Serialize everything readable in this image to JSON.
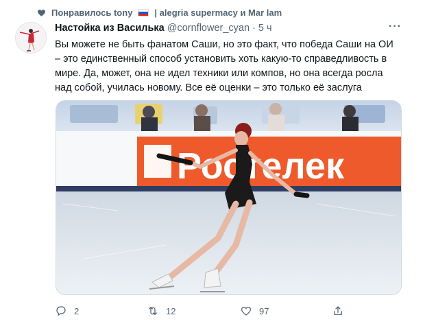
{
  "liked": {
    "prefix": "Понравилось tony",
    "suffix": "| alegria supermacy и Mar lam",
    "flag": "russia-flag"
  },
  "tweet": {
    "author_name": "Настойка из Василька",
    "handle": "@cornflower_cyan",
    "separator": "·",
    "time": "5 ч",
    "more": "···",
    "text": "Вы можете не быть фанатом Саши, но это факт, что победа Саши на ОИ\n– это единственный способ установить хоть какую-то справедливость в\nмире. Да, может, она не идел техники или компов, но она всегда росла\nнад собой, училась новому. Все её оценки  – это только её заслуга",
    "image": {
      "banner_text": "Ростелек",
      "subject": "figure-skater-photo"
    },
    "actions": {
      "reply_count": "2",
      "retweet_count": "12",
      "like_count": "97"
    }
  },
  "colors": {
    "text": "#0f1419",
    "secondary": "#536471",
    "banner_orange": "#ee5a2b",
    "ice": "#dfe6ee"
  }
}
